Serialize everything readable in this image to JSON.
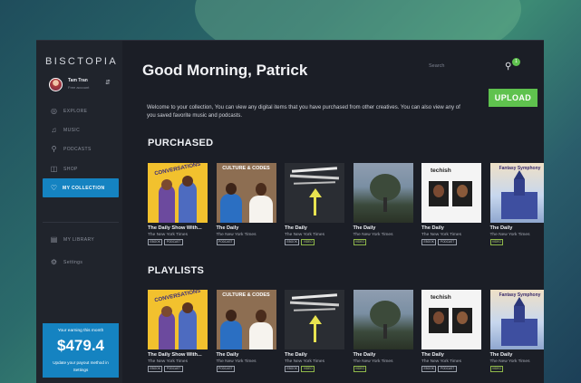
{
  "app": {
    "logo": "BISCTOPIA"
  },
  "user": {
    "name": "Tam Tran",
    "account_type": "Free account"
  },
  "nav": {
    "items": [
      {
        "label": "EXPLORE",
        "icon": "compass-icon"
      },
      {
        "label": "MUSIC",
        "icon": "music-note-icon"
      },
      {
        "label": "PODCASTS",
        "icon": "microphone-icon"
      },
      {
        "label": "SHOP",
        "icon": "shop-icon"
      },
      {
        "label": "MY COLLECTION",
        "icon": "heart-icon"
      }
    ],
    "secondary": [
      {
        "label": "MY LIBRARY",
        "icon": "library-icon"
      },
      {
        "label": "Settings",
        "icon": "gear-icon"
      }
    ]
  },
  "earnings": {
    "title": "Your earning this month",
    "amount": "$479.4",
    "note": "Update your payout method in Settings"
  },
  "header": {
    "greeting": "Good Morning, Patrick",
    "search_placeholder": "Search",
    "notification_count": "1",
    "upload_label": "UPLOAD"
  },
  "welcome_text": "Welcome to your collection, You can view any digital items that you have purchased from other creatives. You can also view any of you saved favorite music and podcasts.",
  "sections": {
    "purchased": {
      "title": "PURCHASED",
      "cards": [
        {
          "art": "conversations",
          "title": "The Daily Show With...",
          "subtitle": "The New York Times",
          "tags": [
            "EBOOK",
            "PODCAST"
          ]
        },
        {
          "art": "culture",
          "title": "The Daily",
          "subtitle": "The New York Times",
          "tags": [
            "PODCAST"
          ]
        },
        {
          "art": "dark",
          "title": "The Daily",
          "subtitle": "The New York Times",
          "tags": [
            "EBOOK",
            "VIDEO"
          ]
        },
        {
          "art": "tree",
          "title": "The Daily",
          "subtitle": "The New York Times",
          "tags": [
            "VIDEO"
          ]
        },
        {
          "art": "tech",
          "title": "The Daily",
          "subtitle": "The New York Times",
          "tags": [
            "EBOOK",
            "PODCAST"
          ]
        },
        {
          "art": "fantasy",
          "title": "The Daily",
          "subtitle": "The New York Times",
          "tags": [
            "VIDEO"
          ]
        }
      ]
    },
    "playlists": {
      "title": "PLAYLISTS",
      "cards": [
        {
          "art": "conversations",
          "title": "The Daily Show With...",
          "subtitle": "The New York Times",
          "tags": [
            "EBOOK",
            "PODCAST"
          ]
        },
        {
          "art": "culture",
          "title": "The Daily",
          "subtitle": "The New York Times",
          "tags": [
            "PODCAST"
          ]
        },
        {
          "art": "dark",
          "title": "The Daily",
          "subtitle": "The New York Times",
          "tags": [
            "EBOOK",
            "VIDEO"
          ]
        },
        {
          "art": "tree",
          "title": "The Daily",
          "subtitle": "The New York Times",
          "tags": [
            "VIDEO"
          ]
        },
        {
          "art": "tech",
          "title": "The Daily",
          "subtitle": "The New York Times",
          "tags": [
            "EBOOK",
            "PODCAST"
          ]
        },
        {
          "art": "fantasy",
          "title": "The Daily",
          "subtitle": "The New York Times",
          "tags": [
            "VIDEO"
          ]
        }
      ]
    }
  },
  "art_text": {
    "conversations": "CONVERSATIONS",
    "culture": "CULTURE & CODES",
    "tech": "techish",
    "fantasy": "Fantasy Symphony"
  },
  "colors": {
    "accent_blue": "#1583c1",
    "upload_green": "#5fc24e",
    "background": "#1b1e26"
  }
}
